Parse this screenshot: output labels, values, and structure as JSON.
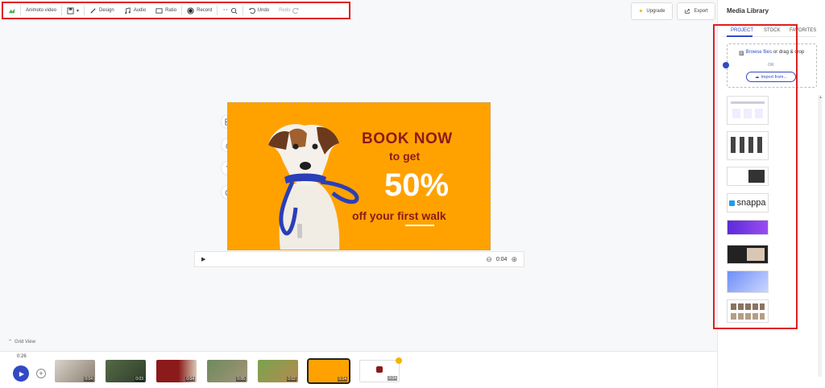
{
  "toolbar": {
    "project_name": "Animoto video",
    "design": "Design",
    "audio": "Audio",
    "ratio": "Ratio",
    "record": "Record",
    "undo": "Undo",
    "redo": "Redo"
  },
  "header_buttons": {
    "upgrade": "Upgrade",
    "export": "Export"
  },
  "canvas": {
    "headline_1": "BOOK NOW",
    "headline_2": "to get",
    "discount": "50%",
    "tagline": "off your first walk"
  },
  "player": {
    "play_icon": "play-icon",
    "duration": "0:04"
  },
  "timeline": {
    "grid_view": "Grid View",
    "total_time": "0:26",
    "clips": [
      {
        "duration": "0:04"
      },
      {
        "duration": "0:03"
      },
      {
        "duration": "0:04"
      },
      {
        "duration": "0:05"
      },
      {
        "duration": "0:02"
      },
      {
        "duration": "0:04"
      },
      {
        "duration": "0:04"
      }
    ]
  },
  "media_library": {
    "title": "Media Library",
    "tabs": [
      "PROJECT",
      "STOCK",
      "FAVORITES"
    ],
    "browse_files": "Browse files",
    "drag_drop": "or drag & drop",
    "or": "OR",
    "import_from": "Import from...",
    "snappa_logo_text": "snappa"
  },
  "colors": {
    "accent": "#3349c4",
    "canvas_bg": "#ffa200",
    "headline": "#8b1a1a",
    "highlight_box": "#e01e1e"
  }
}
